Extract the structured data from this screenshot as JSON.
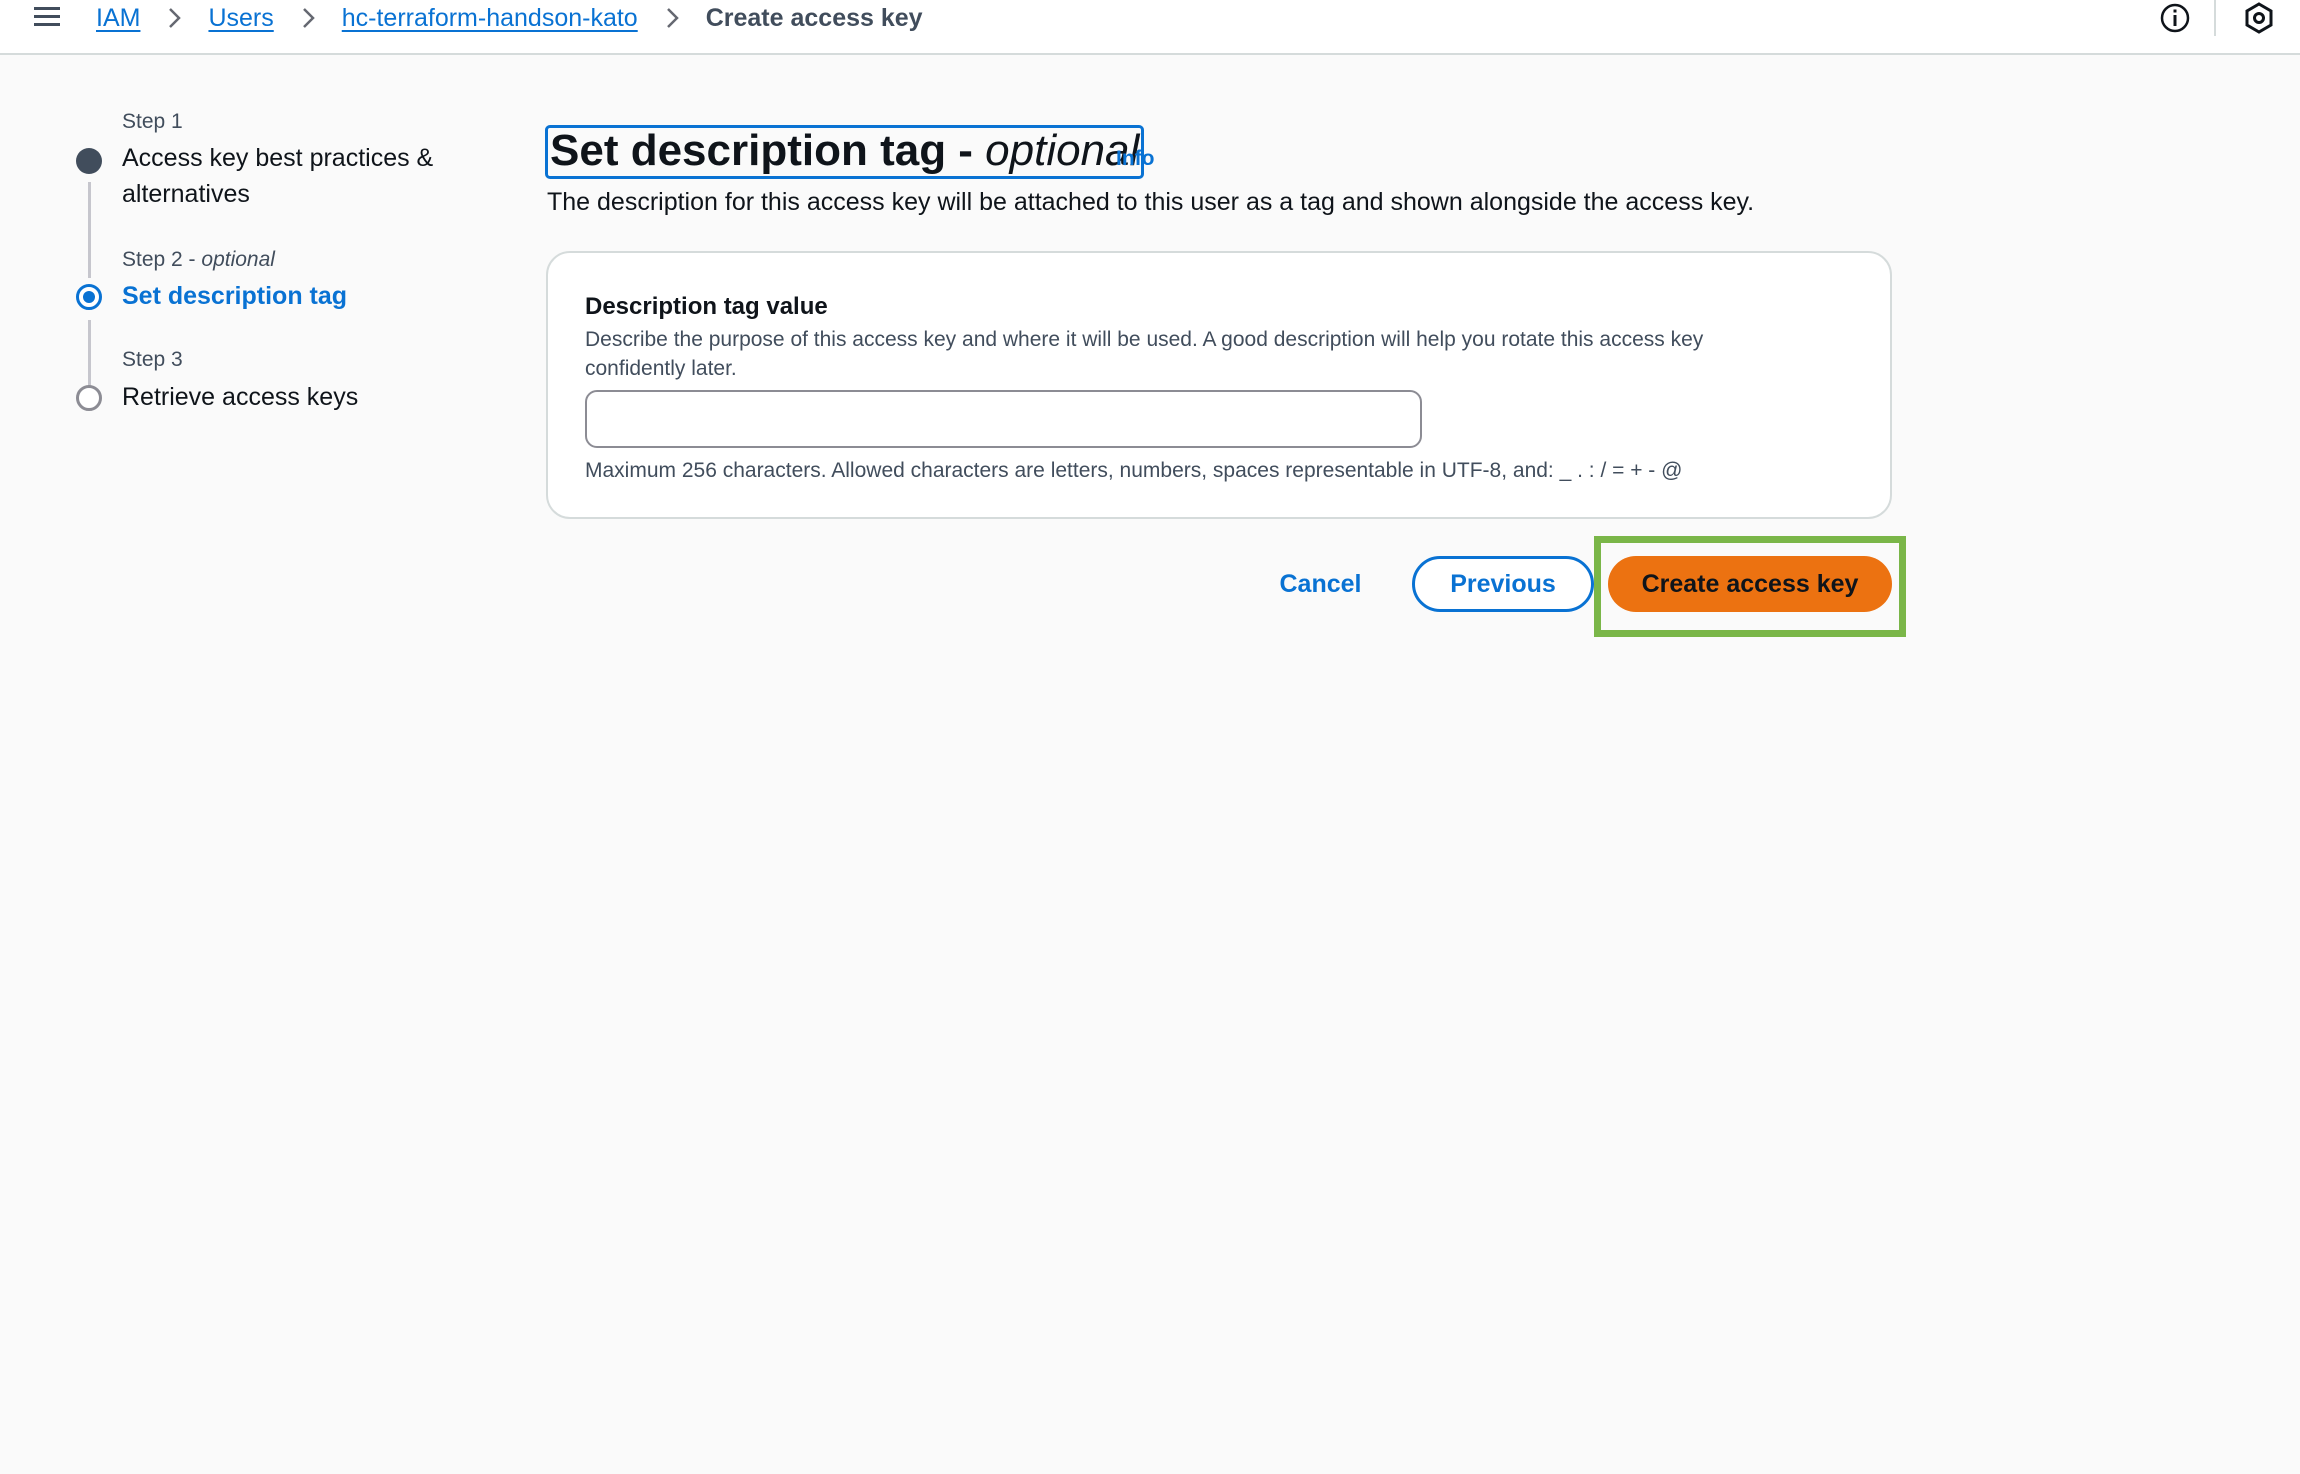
{
  "header": {
    "breadcrumb": {
      "iam": "IAM",
      "users": "Users",
      "user": "hc-terraform-handson-kato",
      "current": "Create access key"
    },
    "icons": [
      "menu-icon",
      "chevron-right-icon",
      "info-icon",
      "settings-hexagon-icon"
    ]
  },
  "steps": [
    {
      "small": "Step 1",
      "label": "Access key best practices &",
      "label2": "alternatives",
      "state": "done"
    },
    {
      "small": "Step 2 - ",
      "small_em": "optional",
      "label": "Set description tag",
      "state": "active"
    },
    {
      "small": "Step 3",
      "label": "Retrieve access keys",
      "state": "todo"
    }
  ],
  "main": {
    "title": "Set description tag - ",
    "title_em": "optional",
    "info": "Info",
    "description": "The description for this access key will be attached to this user as a tag and shown alongside the access key.",
    "field": {
      "label": "Description tag value",
      "help_line1": "Describe the purpose of this access key and where it will be used. A good description will help you rotate this access key",
      "help_line2": "confidently later.",
      "value": "",
      "constraint": "Maximum 256 characters. Allowed characters are letters, numbers, spaces representable in UTF-8, and: _ . : / = + - @"
    }
  },
  "actions": {
    "cancel": "Cancel",
    "previous": "Previous",
    "create": "Create access key"
  },
  "colors": {
    "link": "#0972d3",
    "primary_button": "#ec7211",
    "highlight": "#7ab648"
  }
}
